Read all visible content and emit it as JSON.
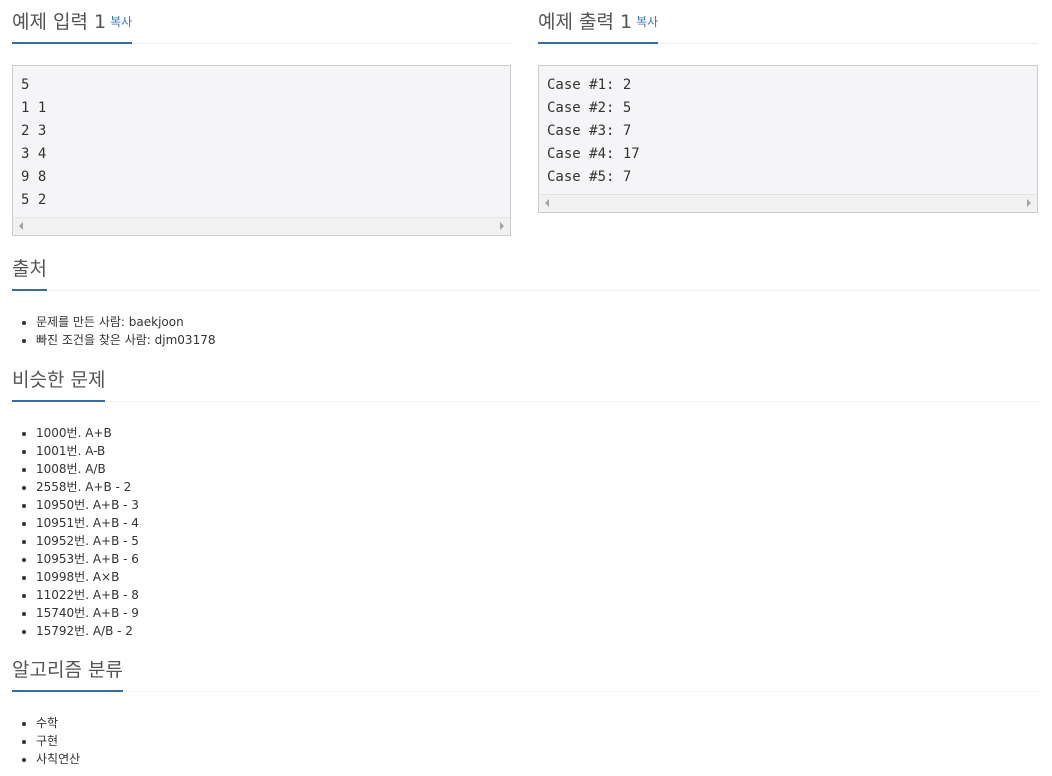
{
  "sample_input": {
    "title": "예제 입력 1",
    "copy_label": "복사",
    "lines": [
      "5",
      "1 1",
      "2 3",
      "3 4",
      "9 8",
      "5 2"
    ]
  },
  "sample_output": {
    "title": "예제 출력 1",
    "copy_label": "복사",
    "lines": [
      "Case #1: 2",
      "Case #2: 5",
      "Case #3: 7",
      "Case #4: 17",
      "Case #5: 7"
    ]
  },
  "source": {
    "title": "출처",
    "items": [
      "문제를 만든 사람: baekjoon",
      "빠진 조건을 찾은 사람: djm03178"
    ]
  },
  "similar": {
    "title": "비슷한 문제",
    "items": [
      "1000번. A+B",
      "1001번. A-B",
      "1008번. A/B",
      "2558번. A+B - 2",
      "10950번. A+B - 3",
      "10951번. A+B - 4",
      "10952번. A+B - 5",
      "10953번. A+B - 6",
      "10998번. A×B",
      "11022번. A+B - 8",
      "15740번. A+B - 9",
      "15792번. A/B - 2"
    ]
  },
  "algorithm": {
    "title": "알고리즘 분류",
    "items": [
      "수학",
      "구현",
      "사칙연산"
    ]
  },
  "colors": {
    "accent_underline": "#3a6d99",
    "link": "#3a76b5",
    "pre_background": "#f5f5f7"
  }
}
